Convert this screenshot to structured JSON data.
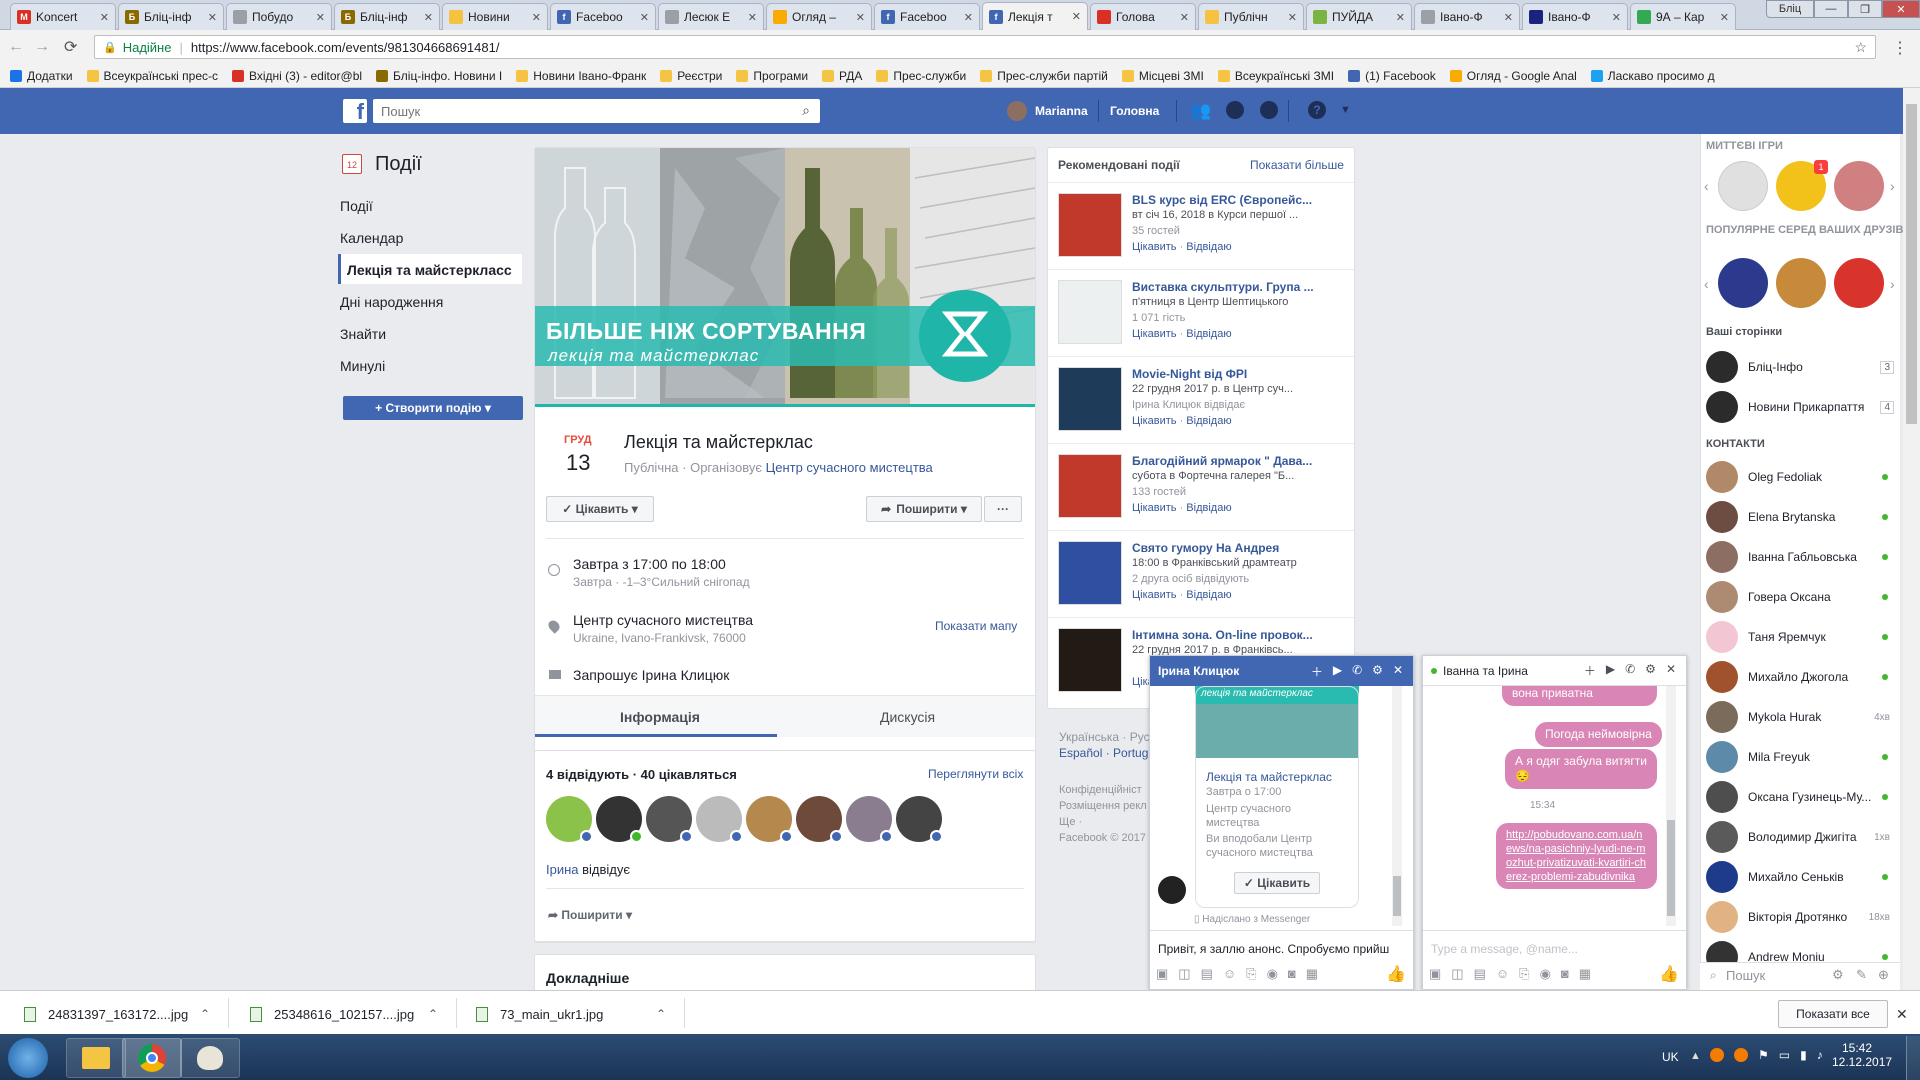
{
  "browser": {
    "tabs": [
      {
        "title": "Koncert",
        "icon_color": "#d93025",
        "icon_char": "M"
      },
      {
        "title": "Бліц-інф",
        "icon_color": "#8a6a00",
        "icon_char": "Б"
      },
      {
        "title": "Побудо",
        "icon_color": "#9aa0a6",
        "icon_char": ""
      },
      {
        "title": "Бліц-інф",
        "icon_color": "#8a6a00",
        "icon_char": "Б"
      },
      {
        "title": "Новини",
        "icon_color": "#f5c242",
        "icon_char": ""
      },
      {
        "title": "Faceboo",
        "icon_color": "#4267b2",
        "icon_char": "f"
      },
      {
        "title": "Лесюк Е",
        "icon_color": "#9aa0a6",
        "icon_char": ""
      },
      {
        "title": "Огляд –",
        "icon_color": "#f9ab00",
        "icon_char": ""
      },
      {
        "title": "Faceboo",
        "icon_color": "#4267b2",
        "icon_char": "f"
      },
      {
        "title": "Лекція т",
        "icon_color": "#4267b2",
        "icon_char": "f"
      },
      {
        "title": "Голова",
        "icon_color": "#d93025",
        "icon_char": ""
      },
      {
        "title": "Публічн",
        "icon_color": "#f5c242",
        "icon_char": ""
      },
      {
        "title": "ПУЙДА",
        "icon_color": "#7cb342",
        "icon_char": ""
      },
      {
        "title": "Івано-Ф",
        "icon_color": "#9aa0a6",
        "icon_char": ""
      },
      {
        "title": "Івано-Ф",
        "icon_color": "#1a237e",
        "icon_char": ""
      },
      {
        "title": "9А – Кар",
        "icon_color": "#34a853",
        "icon_char": ""
      }
    ],
    "user_badge": "Бліц",
    "secure_label": "Надійне",
    "url": "https://www.facebook.com/events/981304668691481/",
    "bookmarks": [
      {
        "label": "Додатки",
        "color": "#1a73e8"
      },
      {
        "label": "Всеукраїнські прес-с",
        "color": "#f4c542"
      },
      {
        "label": "Вхідні (3) - editor@bl",
        "color": "#d93025"
      },
      {
        "label": "Бліц-інфо. Новини І",
        "color": "#8a6a00"
      },
      {
        "label": "Новини Івано-Франк",
        "color": "#f5c242"
      },
      {
        "label": "Реєстри",
        "color": "#f4c542"
      },
      {
        "label": "Програми",
        "color": "#f4c542"
      },
      {
        "label": "РДА",
        "color": "#f4c542"
      },
      {
        "label": "Прес-служби",
        "color": "#f4c542"
      },
      {
        "label": "Прес-служби партій",
        "color": "#f4c542"
      },
      {
        "label": "Місцеві ЗМІ",
        "color": "#f4c542"
      },
      {
        "label": "Всеукраїнські ЗМІ",
        "color": "#f4c542"
      },
      {
        "label": "(1) Facebook",
        "color": "#4267b2"
      },
      {
        "label": "Огляд - Google Anal",
        "color": "#f9ab00"
      },
      {
        "label": "Ласкаво просимо д",
        "color": "#1da1f2"
      }
    ]
  },
  "fb_header": {
    "search_placeholder": "Пошук",
    "user_name": "Marianna",
    "home_label": "Головна"
  },
  "left_nav": {
    "title": "Події",
    "calendar_day": "12",
    "items": [
      "Події",
      "Календар",
      "Лекція та майстеркласс",
      "Дні народження",
      "Знайти",
      "Минулі"
    ],
    "create_button": "+ Створити подію ▾"
  },
  "event": {
    "cover_line1": "БІЛЬШЕ НІЖ СОРТУВАННЯ",
    "cover_line2": "лекція та майстерклас",
    "month": "ГРУД",
    "day": "13",
    "title": "Лекція та майстерклас",
    "privacy": "Публічна",
    "organizer_prefix": "· Організовує",
    "organizer": "Центр сучасного мистецтва",
    "interested_button": "✓ Цікавить ▾",
    "share_button": "Поширити ▾",
    "more_button": "···",
    "time_main": "Завтра з 17:00 по 18:00",
    "time_sub": "Завтра · -1–3°Сильний снігопад",
    "place_main": "Центр сучасного мистецтва",
    "place_sub": "Ukraine, Ivano-Frankivsk, 76000",
    "show_map": "Показати мапу",
    "invited_by": "Запрошує Ірина Клицюк",
    "tabs": [
      "Інформація",
      "Дискусія"
    ],
    "going_summary": "4 відвідують · 40 цікавляться",
    "see_all": "Переглянути всіх",
    "going_name": "Ірина",
    "going_suffix": " відвідує",
    "share_link": "Поширити ▾",
    "details_title": "Докладніше"
  },
  "recommended": {
    "title": "Рекомендовані події",
    "show_more": "Показати більше",
    "items": [
      {
        "title": "BLS курс від ERC (Європейс...",
        "line1": "вт січ 16, 2018 в Курси першої ...",
        "line2": "35 гостей",
        "img": "#c0392b"
      },
      {
        "title": "Виставка скульптури. Група ...",
        "line1": "п'ятниця в Центр Шептицького",
        "line2": "1 071 гість",
        "img": "#ecf0f1"
      },
      {
        "title": "Movie-Night від ФРІ",
        "line1": "22 грудня 2017 р. в Центр суч...",
        "line2": "Ірина Клицюк відвідає",
        "img": "#1f3b5a"
      },
      {
        "title": "Благодійний ярмарок \" Дава...",
        "line1": "субота в Фортечна галерея \"Б...",
        "line2": "133 гостей",
        "img": "#c0392b"
      },
      {
        "title": "Свято гумору На Андрея",
        "line1": "18:00 в Франківський драмтеатр",
        "line2": "2 друга осіб відвідують",
        "img": "#2f4fa0"
      },
      {
        "title": "Інтимна зона. On-line провок...",
        "line1": "22 грудня 2017 р. в Франківсь...",
        "line2": "",
        "img": "#221a14"
      }
    ],
    "action_interested": "Цікавить",
    "action_going": "Відвідаю",
    "languages": "Українська · Русс",
    "languages2": "Español · Portugu",
    "footer1": "Конфіденційніст",
    "footer2": "Розміщення рекл",
    "footer3": "Ще ·",
    "footer4": "Facebook © 2017"
  },
  "right_panel": {
    "instant_games": "МИТТЄВІ ІГРИ",
    "popular_games": "ПОПУЛЯРНЕ СЕРЕД ВАШИХ ДРУЗІВ",
    "your_pages": "Ваші сторінки",
    "pages": [
      {
        "name": "Бліц-Інфо",
        "badge": "3"
      },
      {
        "name": "Новини Прикарпаття",
        "badge": "4"
      }
    ],
    "contacts_title": "КОНТАКТИ",
    "contacts": [
      {
        "name": "Oleg Fedoliak",
        "status": "",
        "color": "#b08968"
      },
      {
        "name": "Elena Brytanska",
        "status": "",
        "color": "#6d4c41"
      },
      {
        "name": "Іванна Габльовська",
        "status": "",
        "color": "#8d6e63"
      },
      {
        "name": "Говера Оксана",
        "status": "",
        "color": "#ad8b73"
      },
      {
        "name": "Таня Яремчук",
        "status": "",
        "color": "#f3c6d3"
      },
      {
        "name": "Михайло Джогола",
        "status": "",
        "color": "#a0522d"
      },
      {
        "name": "Mykola Hurak",
        "status": "4хв",
        "color": "#7b6b5b"
      },
      {
        "name": "Mila Freyuk",
        "status": "",
        "color": "#5d8aa8"
      },
      {
        "name": "Оксана Гузинець-Му...",
        "status": "",
        "color": "#4e4e4e"
      },
      {
        "name": "Володимир Джигіта",
        "status": "1хв",
        "color": "#5a5a5a"
      },
      {
        "name": "Михайло Сеньків",
        "status": "",
        "color": "#1e3a8a"
      },
      {
        "name": "Вікторія Дротянко",
        "status": "18хв",
        "color": "#e1b382"
      },
      {
        "name": "Andrew Moniu",
        "status": "",
        "color": "#333333"
      }
    ],
    "search_placeholder": "Пошук"
  },
  "chat1": {
    "name": "Ірина Клицюк",
    "card_title": "Лекція та майстерклас",
    "card_when": "Завтра о 17:00",
    "card_where": "Центр сучасного мистецтва",
    "card_note": "Ви вподобали Центр сучасного мистецтва",
    "card_button": "✓ Цікавить",
    "sent_via": "Надіслано з Messenger",
    "input_text": "Привіт, я заллю анонс. Спробуємо прийш"
  },
  "chat2": {
    "name": "Іванна та Ірина",
    "bubbles": [
      "вона приватна",
      "Погода неймовірна",
      "А я одяг забула витягти 😔"
    ],
    "time": "15:34",
    "link_text": "http://pobudovano.com.ua/news/na-pasichniy-lyudi-ne-mozhut-privatizuvati-kvartiri-cherez-problemi-zabudivnika",
    "input_placeholder": "Type a message, @name..."
  },
  "downloads": {
    "files": [
      "24831397_163172....jpg",
      "25348616_102157....jpg",
      "73_main_ukr1.jpg"
    ],
    "show_all": "Показати все"
  },
  "taskbar": {
    "lang": "UK",
    "time": "15:42",
    "date": "12.12.2017"
  },
  "colors": {
    "fb_blue": "#4267b2",
    "link": "#365899",
    "teal": "#1fb5a8",
    "online": "#42b72a",
    "bubble": "#d986b6"
  }
}
